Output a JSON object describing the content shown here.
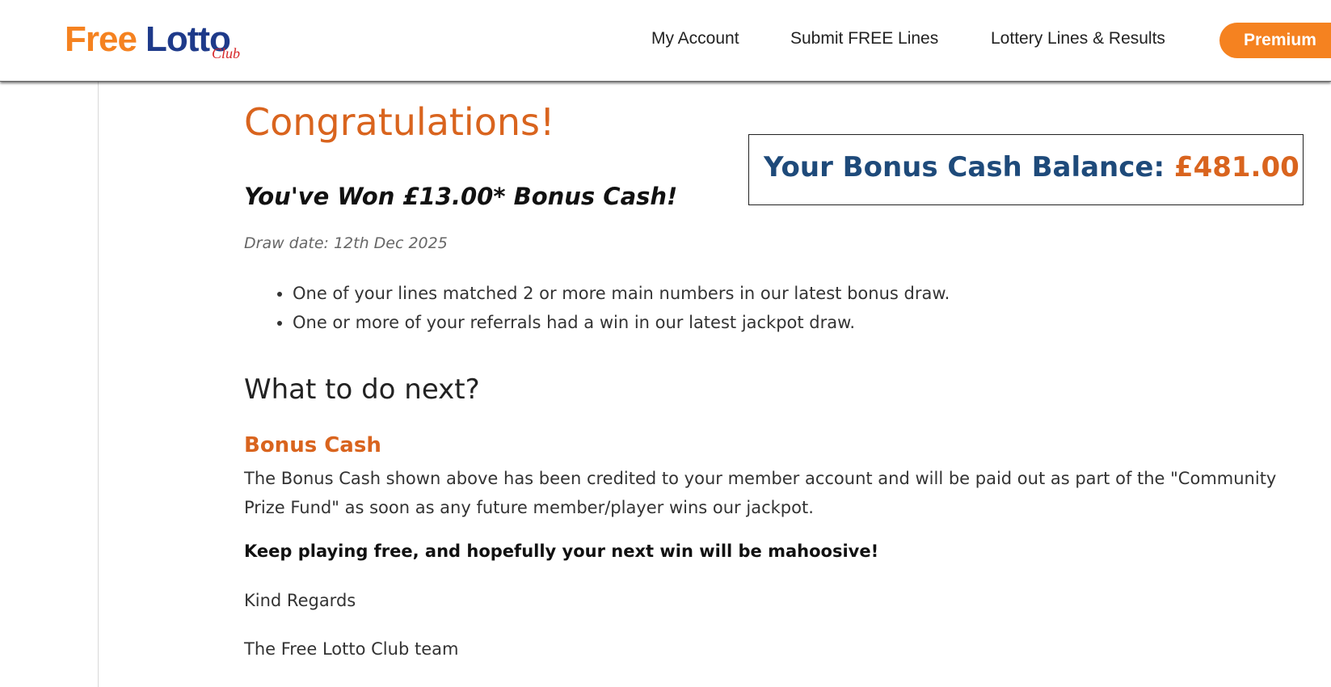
{
  "header": {
    "logo": {
      "free": "Free",
      "lotto": "Lotto",
      "club": "Club"
    },
    "nav": {
      "my_account": "My Account",
      "submit_free_lines": "Submit FREE Lines",
      "lottery_lines_results": "Lottery Lines & Results",
      "premium": "Premium"
    }
  },
  "main": {
    "title": "Congratulations!",
    "won_text": "You've Won £13.00* Bonus Cash!",
    "draw_date": "Draw date: 12th Dec 2025",
    "bullets": [
      "One of your lines matched 2 or more main numbers in our latest bonus draw.",
      "One or more of your referrals had a win in our latest jackpot draw."
    ],
    "next_heading": "What to do next?",
    "bonus_heading": "Bonus Cash",
    "bonus_text": "The Bonus Cash shown above has been credited to your member account and will be paid out as part of the \"Community Prize Fund\" as soon as any future member/player wins our jackpot.",
    "keep_playing": "Keep playing free, and hopefully your next win will be mahoosive!",
    "regards": "Kind Regards",
    "team": "The Free Lotto Club team"
  },
  "balance": {
    "label": "Your Bonus Cash Balance: ",
    "value": "£481.00"
  },
  "colors": {
    "brand_orange": "#f58220",
    "heading_orange": "#d9641e",
    "brand_navy": "#1e3a8a",
    "balance_blue": "#1e4a7a",
    "club_red": "#d6282a"
  }
}
